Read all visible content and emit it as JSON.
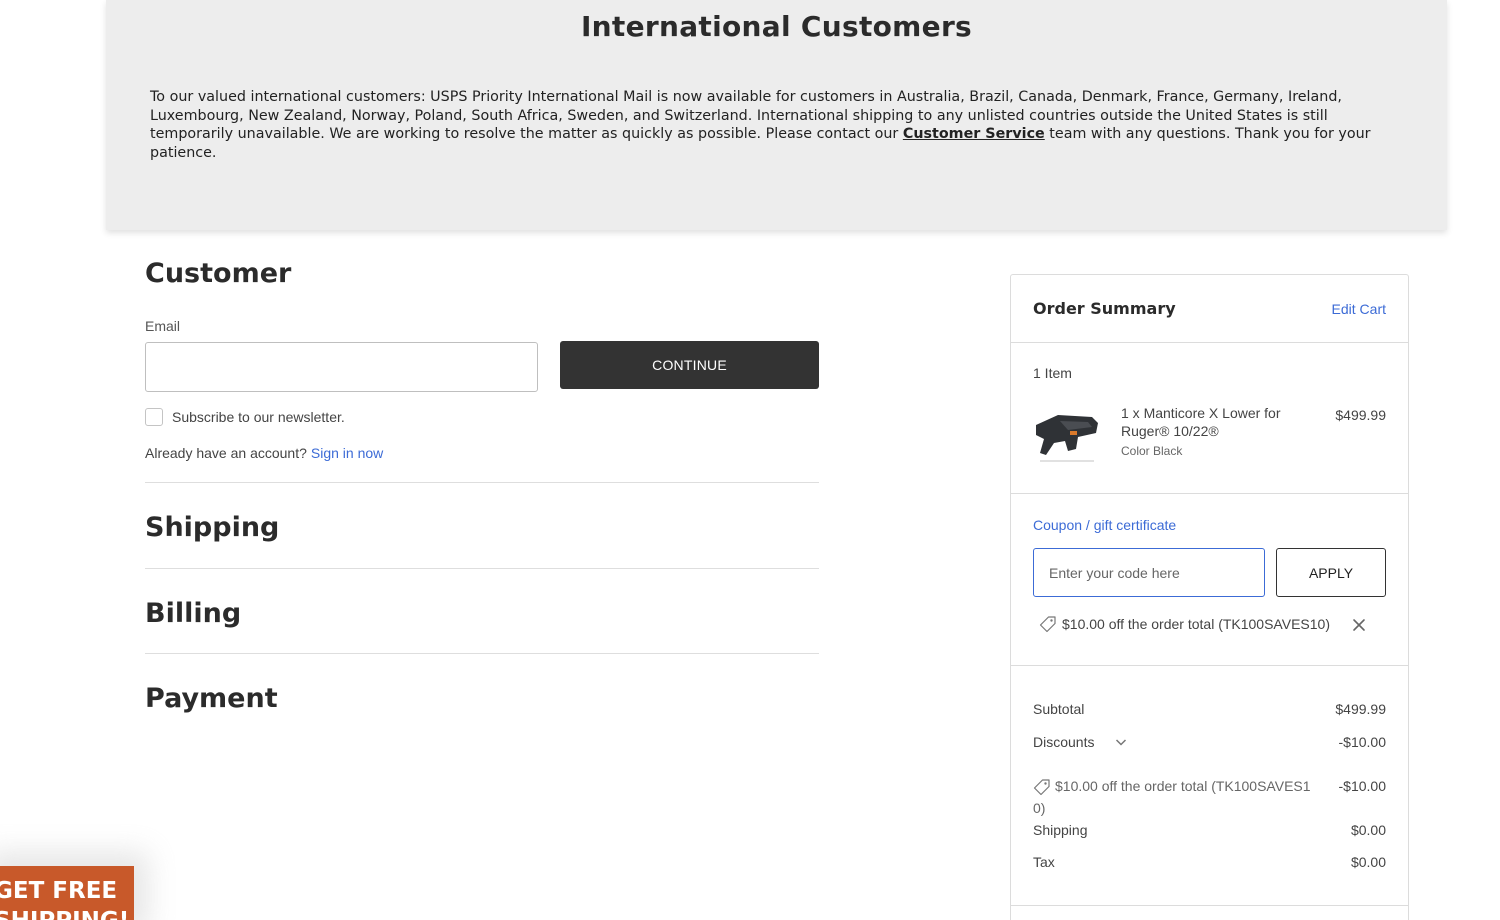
{
  "notice": {
    "title": "International Customers",
    "text_before_link": "To our valued international customers: USPS Priority International Mail is now available for customers in Australia, Brazil, Canada, Denmark, France, Germany, Ireland, Luxembourg, New Zealand, Norway, Poland, South Africa, Sweden, and Switzerland. International shipping to any unlisted countries outside the United States is still temporarily unavailable. We are working to resolve the matter as quickly as possible. Please contact our ",
    "link_text": "Customer Service",
    "text_after_link": " team with any questions. Thank you for your patience."
  },
  "checkout": {
    "customer": {
      "title": "Customer",
      "email_label": "Email",
      "email_value": "",
      "continue_label": "CONTINUE",
      "newsletter_label": "Subscribe to our newsletter.",
      "newsletter_checked": false,
      "account_prompt": "Already have an account?",
      "sign_in_label": "Sign in now"
    },
    "steps": [
      {
        "title": "Shipping"
      },
      {
        "title": "Billing"
      },
      {
        "title": "Payment"
      }
    ]
  },
  "summary": {
    "title": "Order Summary",
    "edit_cart_label": "Edit Cart",
    "item_count": "1 Item",
    "product": {
      "name": "1 x Manticore X Lower for Ruger® 10/22®",
      "option": "Color Black",
      "price": "$499.99"
    },
    "coupon": {
      "toggle_label": "Coupon / gift certificate",
      "placeholder": "Enter your code here",
      "value": "",
      "apply_label": "APPLY",
      "applied_text": "$10.00 off the order total (TK100SAVES10)"
    },
    "totals": {
      "subtotal_label": "Subtotal",
      "subtotal_value": "$499.99",
      "discounts_label": "Discounts",
      "discounts_value": "-$10.00",
      "discount_detail_text": "$10.00 off the order total (TK100SAVES10)",
      "discount_detail_value": "-$10.00",
      "shipping_label": "Shipping",
      "shipping_value": "$0.00",
      "tax_label": "Tax",
      "tax_value": "$0.00"
    }
  },
  "promo": {
    "line1": "GET FREE",
    "line2": "SHIPPING!"
  },
  "icons": {
    "tag": "tag-icon",
    "close": "close-icon",
    "chevron": "chevron-down-icon",
    "checkbox": "checkbox-icon"
  },
  "colors": {
    "link": "#3c6bd6",
    "primary_button": "#333333",
    "promo": "#c8592a",
    "banner_bg": "#ededed"
  }
}
